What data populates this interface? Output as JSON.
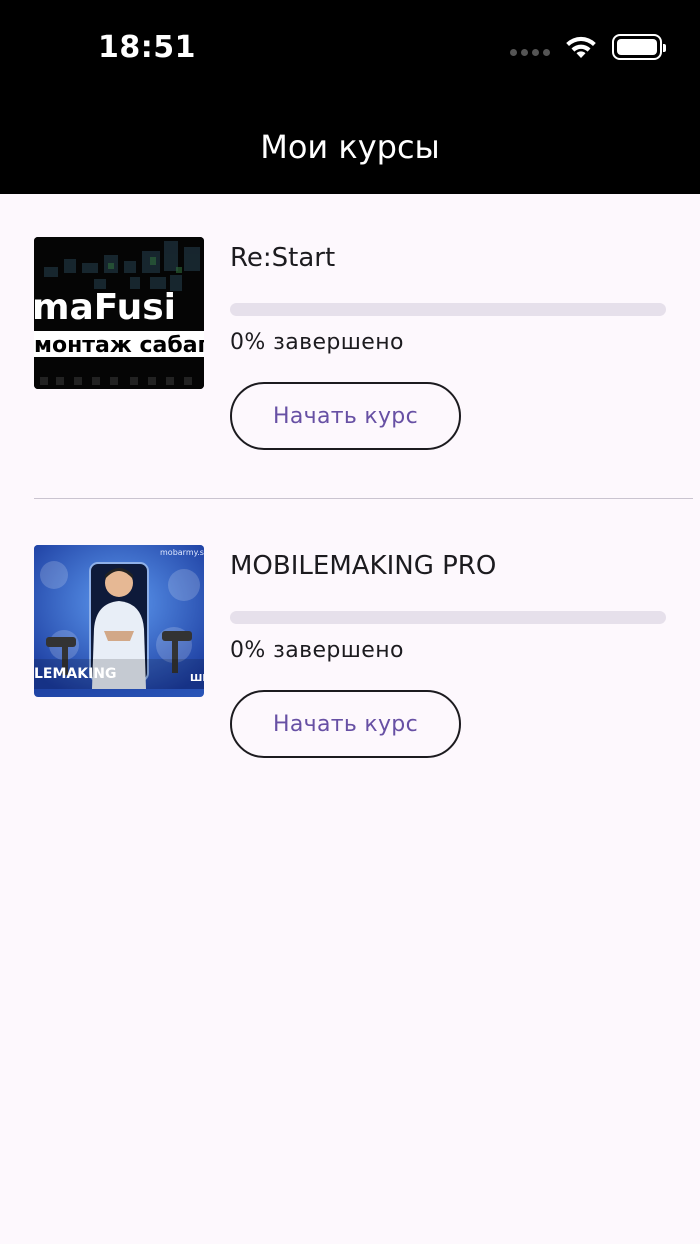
{
  "status_bar": {
    "time": "18:51",
    "icons": [
      "signal-dots-icon",
      "wifi-icon",
      "battery-icon"
    ]
  },
  "header": {
    "title": "Мои курсы"
  },
  "courses": [
    {
      "title": "Re:Start",
      "progress": 0,
      "progress_label": "0% завершено",
      "button_label": "Начать курс",
      "thumbnail_text": [
        "maFusi",
        "монтаж сабаг"
      ]
    },
    {
      "title": "MOBILEMAKING PRO",
      "progress": 0,
      "progress_label": "0% завершено",
      "button_label": "Начать курс",
      "thumbnail_text": [
        "mobarmy.sc",
        "LEMAKING",
        "ШЕ"
      ]
    }
  ],
  "colors": {
    "accent": "#6750a4",
    "background": "#fdf8fd",
    "header": "#000000",
    "track": "#e6e0eb"
  }
}
